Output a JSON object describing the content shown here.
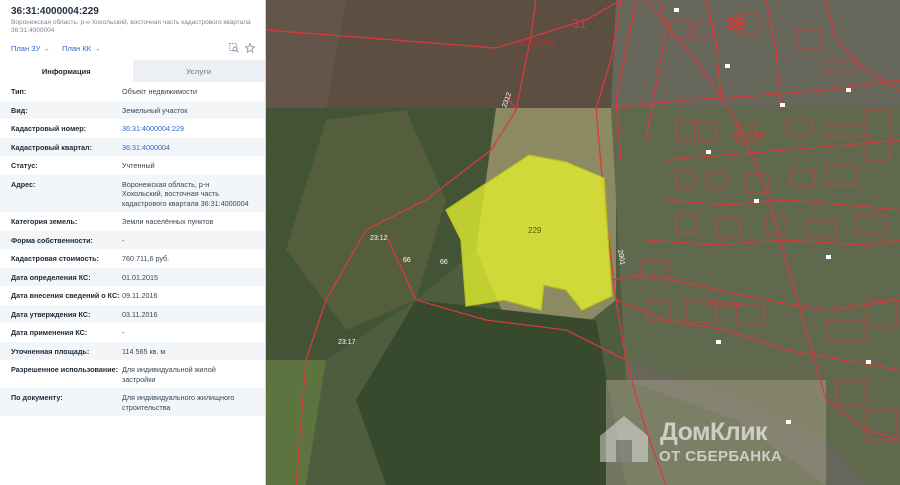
{
  "panel": {
    "title": "36:31:4000004:229",
    "subtitle": "Воронежская область, р-н Хохольский, восточная часть кадастрового квартала 36:31:4000004",
    "actions": {
      "plan_zu": "План ЗУ →",
      "plan_kk": "План КК →"
    },
    "tabs": [
      {
        "label": "Информация"
      },
      {
        "label": "Услуги"
      }
    ],
    "rows": [
      {
        "label": "Тип:",
        "value": "Объект недвижимости"
      },
      {
        "label": "Вид:",
        "value": "Земельный участок"
      },
      {
        "label": "Кадастровый номер:",
        "value": "36:31:4000004:229"
      },
      {
        "label": "Кадастровый квартал:",
        "value": "36:31:4000004"
      },
      {
        "label": "Статус:",
        "value": "Учтенный"
      },
      {
        "label": "Адрес:",
        "value": "Воронежская область, р-н Хохольский, восточная часть кадастрового квартала 36:31:4000004"
      },
      {
        "label": "Категория земель:",
        "value": "Земли населённых пунктов"
      },
      {
        "label": "Форма собственности:",
        "value": "-"
      },
      {
        "label": "Кадастровая стоимость:",
        "value": "760 711,6 руб."
      },
      {
        "label": "Дата определения КС:",
        "value": "01.01.2015"
      },
      {
        "label": "Дата внесения сведений о КС:",
        "value": "09.11.2016"
      },
      {
        "label": "Дата утверждения КС:",
        "value": "03.11.2016"
      },
      {
        "label": "Дата применения КС:",
        "value": "-"
      },
      {
        "label": "Уточненная площадь:",
        "value": "114 565 кв. м"
      },
      {
        "label": "Разрешенное использование:",
        "value": "Для индивидуальной жилой застройки"
      },
      {
        "label": "По документу:",
        "value": "Для индивидуального жилищного строительства"
      }
    ]
  },
  "map": {
    "labels": {
      "quarter_31": "31",
      "quarter_36": "36",
      "q_4000004": "4000004",
      "q_7000004": "7000004",
      "q_7000005": "7000005",
      "parcel": "229",
      "n66a": "66",
      "n66b": "66",
      "n23_12": "23:12",
      "n23_17": "23:17",
      "n2312": "2312",
      "n2001": "2001"
    },
    "colors": {
      "selected_fill": "#e3f02e",
      "boundary": "#d83a3a",
      "field": "#6a5a4a"
    }
  },
  "watermark": {
    "brand": "ДомКлик",
    "sub": "ОТ СБЕРБАНКА",
    "icon": "house-logo-icon"
  }
}
